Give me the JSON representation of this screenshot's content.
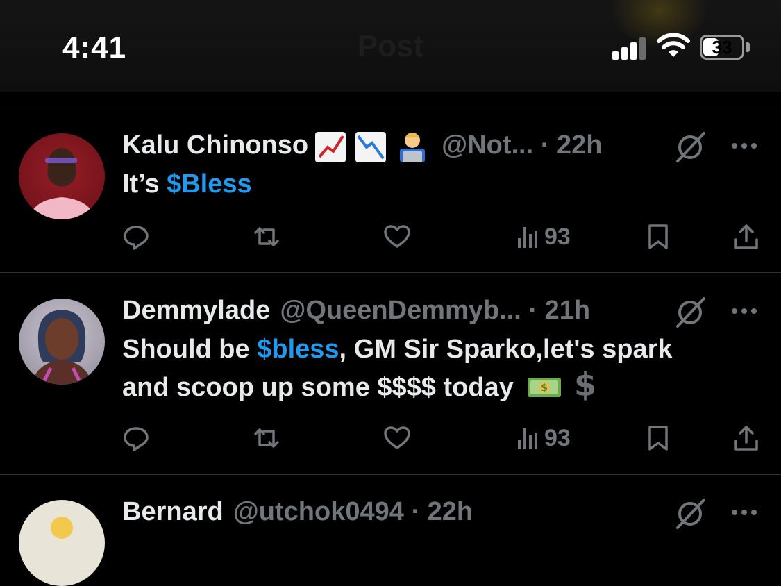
{
  "status_bar": {
    "time": "4:41",
    "title": "Post",
    "battery": "33",
    "signal_icon": "cellular-signal-icon",
    "wifi_icon": "wifi-icon"
  },
  "colors": {
    "background": "#000000",
    "text": "#e7e9ea",
    "muted": "#71767b",
    "cashtag": "#1d9bf0",
    "divider": "#2f3336"
  },
  "replies": [
    {
      "name": "Kalu Chinonso",
      "name_emojis": [
        "chart-increasing-emoji",
        "chart-decreasing-emoji",
        "technologist-emoji"
      ],
      "handle": "@Not...",
      "separator": "·",
      "time": "22h",
      "text_before": "It’s ",
      "cashtag": "$Bless",
      "text_after": "",
      "text_line2": "",
      "views": "93"
    },
    {
      "name": "Demmylade",
      "handle": "@QueenDemmyb...",
      "separator": "·",
      "time": "21h",
      "text_before": "Should be ",
      "cashtag": "$bless",
      "text_after": ", GM Sir Sparko,let's spark",
      "text_line2": "and scoop up some $$$$ today",
      "text_emojis": [
        "banknote-emoji",
        "heavy-dollar-sign-emoji"
      ],
      "views": "93"
    },
    {
      "name": "Bernard",
      "handle": "@utchok0494",
      "separator": "·",
      "time": "22h"
    }
  ]
}
